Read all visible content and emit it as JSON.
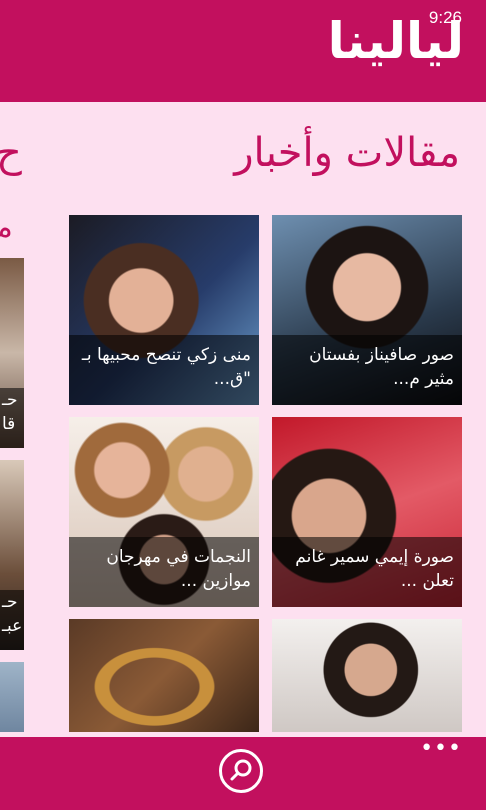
{
  "status": {
    "time": "9:26"
  },
  "app": {
    "logo": "ليالينا",
    "brand_color": "#c2105e",
    "background": "#fde0f0"
  },
  "pivot": {
    "title": "مقالات وأخبار",
    "next_peek": "ح",
    "sub_peek": "م"
  },
  "tiles": [
    {
      "caption": "صور صافيناز بفستان مثير م..."
    },
    {
      "caption": "منى زكي تنصح محبيها بـ \"ق..."
    },
    {
      "caption": "صورة إيمي سمير غانم تعلن ..."
    },
    {
      "caption": "النجمات في مهرجان موازين ..."
    },
    {
      "caption": ""
    },
    {
      "caption": ""
    }
  ],
  "left_peek": [
    {
      "caption": "حـ\nقا"
    },
    {
      "caption": "حـ\nعبـ"
    }
  ],
  "appbar": {
    "search_icon": "search-icon",
    "more_label": "•••"
  }
}
